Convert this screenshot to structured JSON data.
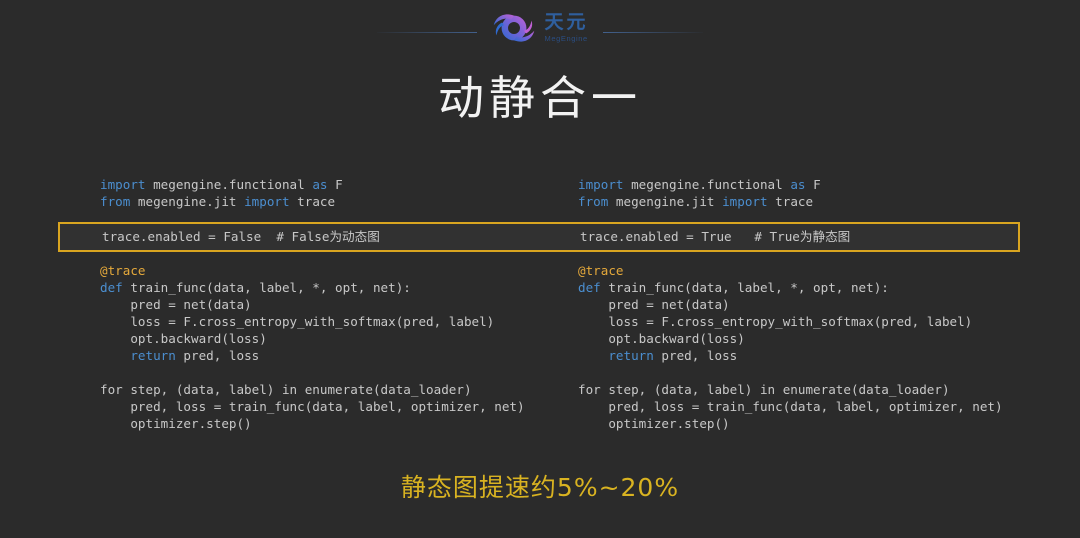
{
  "page": {
    "background_color": "#2b2b2b",
    "title": "动静合一"
  },
  "header": {
    "logo": {
      "icon_name": "megengine-swirl-logo",
      "cn_name": "天元",
      "en_name": "MegEngine",
      "gradient_from": "#3a73d6",
      "gradient_to": "#b961d9",
      "text_color": "#2f5f9e"
    },
    "divider_color": "#466a9e"
  },
  "code": {
    "columns": [
      {
        "id": "dynamic-graph",
        "imports": [
          {
            "parts": [
              {
                "t": "import",
                "c": "kw"
              },
              {
                "t": " megengine.functional ",
                "c": "pl"
              },
              {
                "t": "as",
                "c": "kw"
              },
              {
                "t": " F",
                "c": "pl"
              }
            ]
          },
          {
            "parts": [
              {
                "t": "from",
                "c": "kw"
              },
              {
                "t": " megengine.jit ",
                "c": "pl"
              },
              {
                "t": "import",
                "c": "kw"
              },
              {
                "t": " trace",
                "c": "pl"
              }
            ]
          }
        ],
        "toggle_line": "trace.enabled = False  # False为动态图",
        "body": [
          {
            "parts": [
              {
                "t": "@trace",
                "c": "dec"
              }
            ]
          },
          {
            "parts": [
              {
                "t": "def",
                "c": "kw"
              },
              {
                "t": " train_func(data, label, *, opt, net):",
                "c": "pl"
              }
            ]
          },
          {
            "parts": [
              {
                "t": "    pred = net(data)",
                "c": "pl"
              }
            ]
          },
          {
            "parts": [
              {
                "t": "    loss = F.cross_entropy_with_softmax(pred, label)",
                "c": "pl"
              }
            ]
          },
          {
            "parts": [
              {
                "t": "    opt.backward(loss)",
                "c": "pl"
              }
            ]
          },
          {
            "parts": [
              {
                "t": "    ",
                "c": "pl"
              },
              {
                "t": "return",
                "c": "kw"
              },
              {
                "t": " pred, loss",
                "c": "pl"
              }
            ]
          },
          {
            "parts": [
              {
                "t": "",
                "c": "pl"
              }
            ]
          },
          {
            "parts": [
              {
                "t": "for step, (data, label) in enumerate(data_loader)",
                "c": "pl"
              }
            ]
          },
          {
            "parts": [
              {
                "t": "    pred, loss = train_func(data, label, optimizer, net)",
                "c": "pl"
              }
            ]
          },
          {
            "parts": [
              {
                "t": "    optimizer.step()",
                "c": "pl"
              }
            ]
          }
        ]
      },
      {
        "id": "static-graph",
        "imports": [
          {
            "parts": [
              {
                "t": "import",
                "c": "kw"
              },
              {
                "t": " megengine.functional ",
                "c": "pl"
              },
              {
                "t": "as",
                "c": "kw"
              },
              {
                "t": " F",
                "c": "pl"
              }
            ]
          },
          {
            "parts": [
              {
                "t": "from",
                "c": "kw"
              },
              {
                "t": " megengine.jit ",
                "c": "pl"
              },
              {
                "t": "import",
                "c": "kw"
              },
              {
                "t": " trace",
                "c": "pl"
              }
            ]
          }
        ],
        "toggle_line": "trace.enabled = True   # True为静态图",
        "body": [
          {
            "parts": [
              {
                "t": "@trace",
                "c": "dec"
              }
            ]
          },
          {
            "parts": [
              {
                "t": "def",
                "c": "kw"
              },
              {
                "t": " train_func(data, label, *, opt, net):",
                "c": "pl"
              }
            ]
          },
          {
            "parts": [
              {
                "t": "    pred = net(data)",
                "c": "pl"
              }
            ]
          },
          {
            "parts": [
              {
                "t": "    loss = F.cross_entropy_with_softmax(pred, label)",
                "c": "pl"
              }
            ]
          },
          {
            "parts": [
              {
                "t": "    opt.backward(loss)",
                "c": "pl"
              }
            ]
          },
          {
            "parts": [
              {
                "t": "    ",
                "c": "pl"
              },
              {
                "t": "return",
                "c": "kw"
              },
              {
                "t": " pred, loss",
                "c": "pl"
              }
            ]
          },
          {
            "parts": [
              {
                "t": "",
                "c": "pl"
              }
            ]
          },
          {
            "parts": [
              {
                "t": "for step, (data, label) in enumerate(data_loader)",
                "c": "pl"
              }
            ]
          },
          {
            "parts": [
              {
                "t": "    pred, loss = train_func(data, label, optimizer, net)",
                "c": "pl"
              }
            ]
          },
          {
            "parts": [
              {
                "t": "    optimizer.step()",
                "c": "pl"
              }
            ]
          }
        ]
      }
    ],
    "highlight_border_color": "#d9a520",
    "keyword_color": "#4b8ecf",
    "decorator_color": "#e5a93b",
    "text_color": "#c8c8c8"
  },
  "footer": {
    "note": "静态图提速约5%~20%",
    "color": "#d9b321"
  }
}
